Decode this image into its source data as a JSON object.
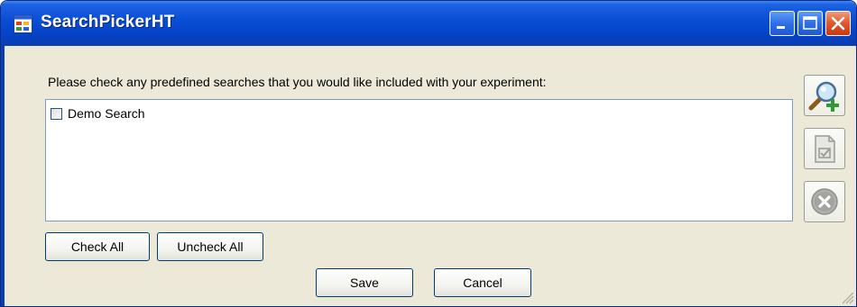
{
  "window": {
    "title": "SearchPickerHT"
  },
  "main": {
    "prompt": "Please check any predefined searches that you would like included with your experiment:",
    "searches": [
      {
        "label": "Demo Search",
        "checked": false
      }
    ]
  },
  "buttons": {
    "check_all": "Check All",
    "uncheck_all": "Uncheck All",
    "save": "Save",
    "cancel": "Cancel"
  },
  "side_toolbar": {
    "icons": [
      "search-add-icon",
      "edit-document-icon",
      "delete-icon"
    ]
  },
  "colors": {
    "titlebar": "#0a4fd6",
    "window_bg": "#ece9d8",
    "close_button": "#e0552a"
  }
}
